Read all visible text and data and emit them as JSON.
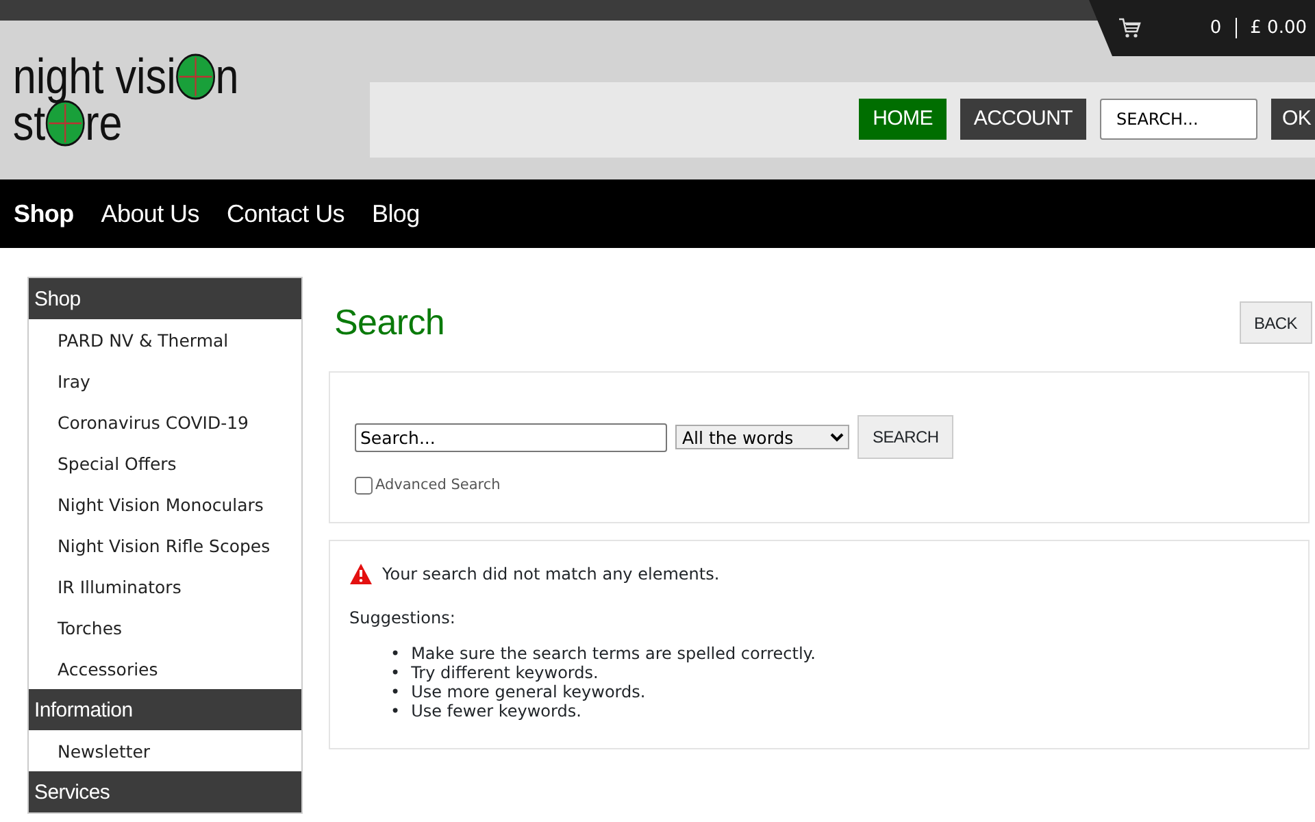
{
  "cart": {
    "count": "0",
    "total": "£ 0.00"
  },
  "logo": {
    "lines": [
      [
        "night visi",
        "n"
      ],
      [
        "st",
        "re"
      ]
    ]
  },
  "header_buttons": [
    {
      "label": "HOME",
      "selected": true
    },
    {
      "label": "ACCOUNT",
      "selected": false
    }
  ],
  "header_search": {
    "value": "SEARCH...",
    "button": "OK"
  },
  "nav": [
    {
      "label": "Shop",
      "selected": true
    },
    {
      "label": "About Us",
      "selected": false
    },
    {
      "label": "Contact Us",
      "selected": false
    },
    {
      "label": "Blog",
      "selected": false
    }
  ],
  "sidebar": [
    {
      "title": "Shop",
      "items": [
        "PARD NV & Thermal",
        "Iray",
        "Coronavirus COVID-19",
        "Special Offers",
        "Night Vision Monoculars",
        "Night Vision Rifle Scopes",
        "IR Illuminators",
        "Torches",
        "Accessories"
      ]
    },
    {
      "title": "Information",
      "items": [
        "Newsletter"
      ]
    },
    {
      "title": "Services"
    }
  ],
  "page": {
    "title": "Search",
    "back": "BACK"
  },
  "search_form": {
    "value": "Search...",
    "mode": "All the words",
    "button": "SEARCH",
    "advanced": {
      "label": "Advanced Search",
      "checked": false
    }
  },
  "result": {
    "message": "Your search did not match any elements.",
    "suggestions_title": "Suggestions:",
    "suggestions": [
      {
        "bullet": "•",
        "text": "Make sure the search terms are spelled correctly."
      },
      {
        "bullet": "•",
        "text": "Try different keywords."
      },
      {
        "bullet": "•",
        "text": "Use more general keywords."
      },
      {
        "bullet": "•",
        "text": "Use fewer keywords."
      }
    ]
  }
}
